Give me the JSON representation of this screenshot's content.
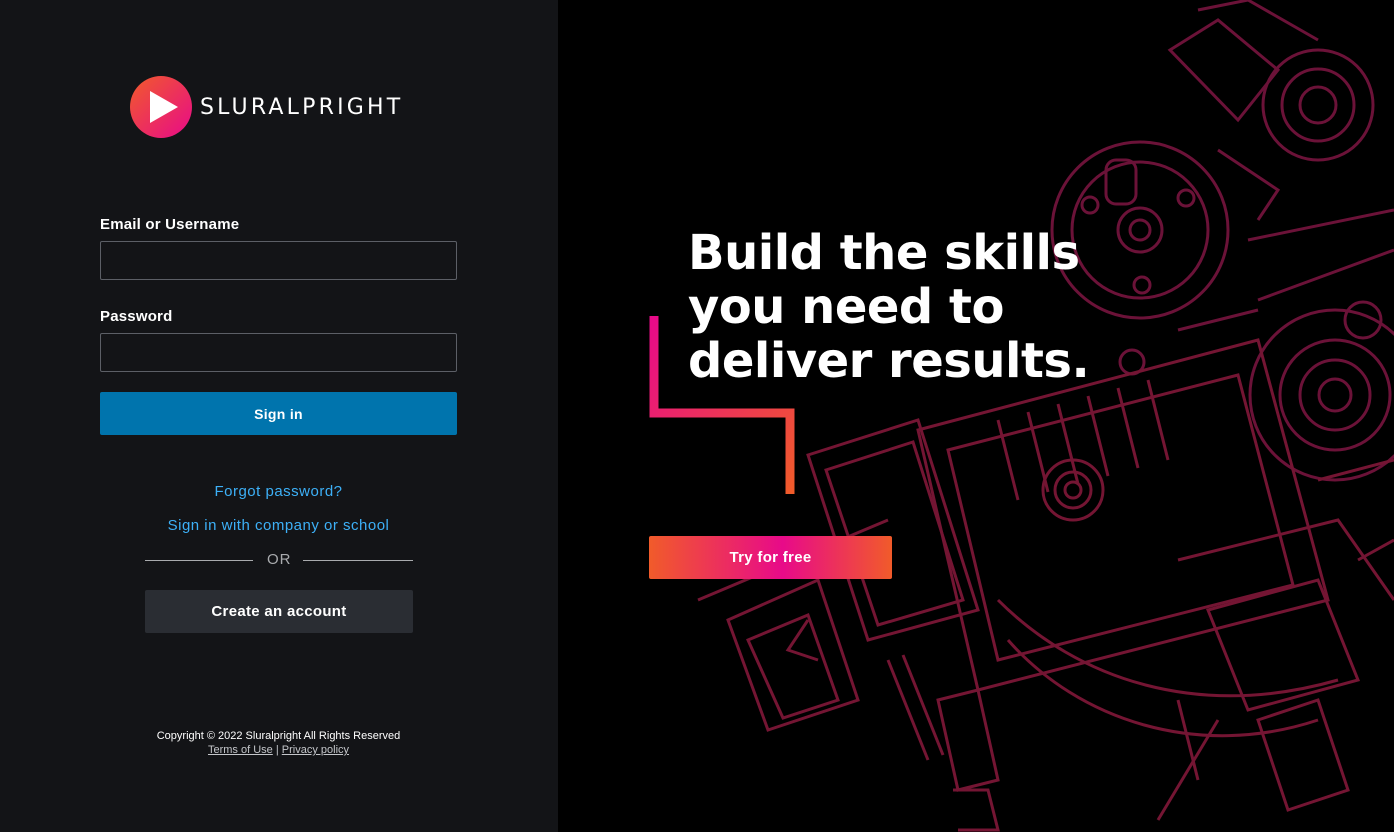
{
  "brand": {
    "name": "SLURALPRIGHT",
    "gradient_start": "#f15b2a",
    "gradient_end": "#e80a89"
  },
  "login_form": {
    "email_label": "Email or Username",
    "email_value": "",
    "email_placeholder": "",
    "password_label": "Password",
    "password_value": "",
    "password_placeholder": "",
    "signin_label": "Sign in",
    "signin_color": "#0074ad"
  },
  "links": {
    "forgot_password": "Forgot password?",
    "company_signin": "Sign in with company or school",
    "or_text": "OR",
    "create_account": "Create an account",
    "link_color": "#3db0f7"
  },
  "footer": {
    "copyright": "Copyright © 2022 Sluralpright All Rights Reserved",
    "terms": "Terms of Use",
    "separator": "|",
    "privacy": "Privacy policy"
  },
  "promo": {
    "headline_line1": "Build the skills",
    "headline_line2": "you need to",
    "headline_line3": "deliver results.",
    "cta": "Try for free",
    "background_art": "blueprint-engine-illustration",
    "art_color": "#7a1233"
  }
}
